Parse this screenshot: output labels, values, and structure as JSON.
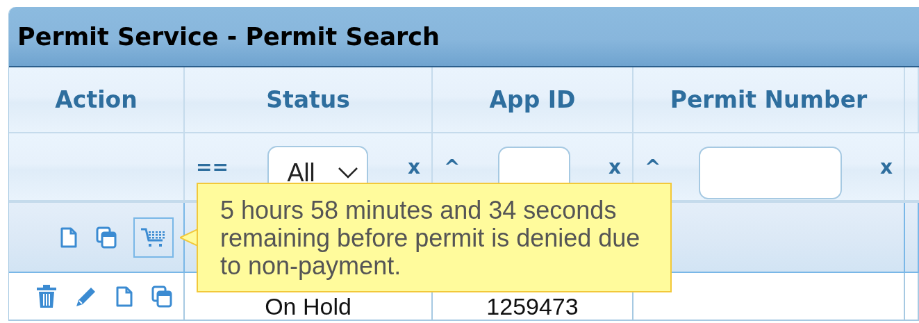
{
  "window": {
    "title": "Permit Service - Permit Search"
  },
  "table": {
    "columns": [
      {
        "label": "Action"
      },
      {
        "label": "Status"
      },
      {
        "label": "App ID"
      },
      {
        "label": "Permit Number"
      }
    ],
    "filters": [
      {
        "kind": "empty"
      },
      {
        "kind": "select",
        "operator": "==",
        "value": "All",
        "clear": "x"
      },
      {
        "kind": "text",
        "operator": "^",
        "clear": "x"
      },
      {
        "kind": "text",
        "operator": "^",
        "clear": "x"
      }
    ],
    "rows": [
      {
        "selected": true,
        "actions": [
          {
            "kind": "document",
            "focused": false
          },
          {
            "kind": "copy",
            "focused": false
          },
          {
            "kind": "cart",
            "focused": true
          }
        ]
      },
      {
        "selected": false,
        "actions": [
          {
            "kind": "trash",
            "focused": false
          },
          {
            "kind": "pencil",
            "focused": false
          },
          {
            "kind": "document",
            "focused": false
          },
          {
            "kind": "copy",
            "focused": false
          }
        ],
        "status": "On Hold",
        "app_id": "1259473"
      }
    ]
  },
  "tooltip": {
    "text": "5 hours 58 minutes and 34 seconds remaining before permit is denied due to non-payment."
  }
}
